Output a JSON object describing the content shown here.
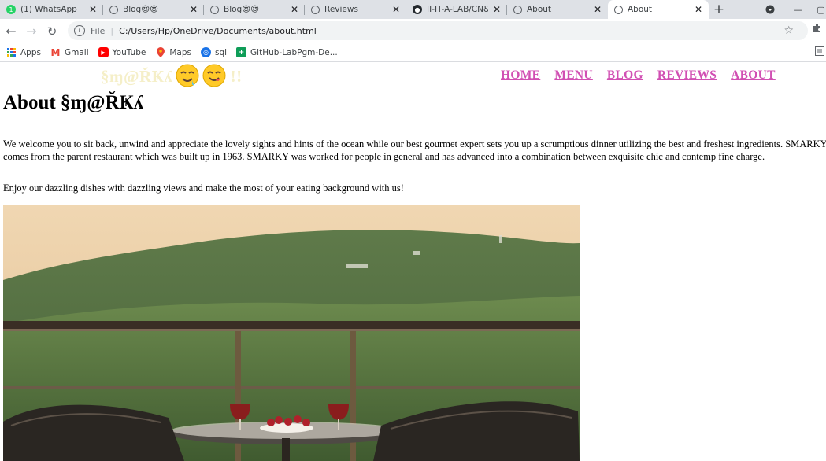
{
  "browser": {
    "tabs": [
      {
        "label": "(1) WhatsApp",
        "icon": "whatsapp-icon",
        "active": false
      },
      {
        "label": "Blog😍😍",
        "icon": "globe-icon",
        "active": false
      },
      {
        "label": "Blog😍😍",
        "icon": "globe-icon",
        "active": false
      },
      {
        "label": "Reviews",
        "icon": "globe-icon",
        "active": false
      },
      {
        "label": "II-IT-A-LAB/CN&",
        "icon": "github-icon",
        "active": false
      },
      {
        "label": "About",
        "icon": "globe-icon",
        "active": false
      },
      {
        "label": "About",
        "icon": "globe-icon",
        "active": true
      }
    ],
    "new_tab": "+",
    "address": {
      "scheme_label": "File",
      "url": "C:/Users/Hp/OneDrive/Documents/about.html"
    },
    "bookmarks": [
      {
        "label": "Apps",
        "icon": "apps-grid-icon"
      },
      {
        "label": "Gmail",
        "icon": "gmail-icon"
      },
      {
        "label": "YouTube",
        "icon": "youtube-icon"
      },
      {
        "label": "Maps",
        "icon": "maps-pin-icon"
      },
      {
        "label": "sql",
        "icon": "sql-icon"
      },
      {
        "label": "GitHub-LabPgm-De...",
        "icon": "github-lab-icon"
      }
    ]
  },
  "site": {
    "brand": "§ɱ@ŘҜʎ",
    "brand_tail": "!!",
    "nav": [
      "HOME",
      "MENU",
      "BLOG",
      "REVIEWS",
      "ABOUT"
    ],
    "heading": "About §ɱ@ŘҜʎ",
    "paragraph1": "We welcome you to sit back, unwind and appreciate the lovely sights and hints of the ocean while our best gourmet expert sets you up a scrumptious dinner utilizing the best and freshest ingredients. SMARKY's legacy comes from the parent restaurant which was built up in 1963. SMARKY was worked for people in general and has advanced into a combination between exquisite chic and contemp fine charge.",
    "paragraph2": "Enjoy our dazzling dishes with dazzling views and make the most of your eating background with us!"
  },
  "colors": {
    "nav_link": "#d14fb3",
    "brand": "#f5efc8",
    "tabstrip": "#dee1e6"
  }
}
